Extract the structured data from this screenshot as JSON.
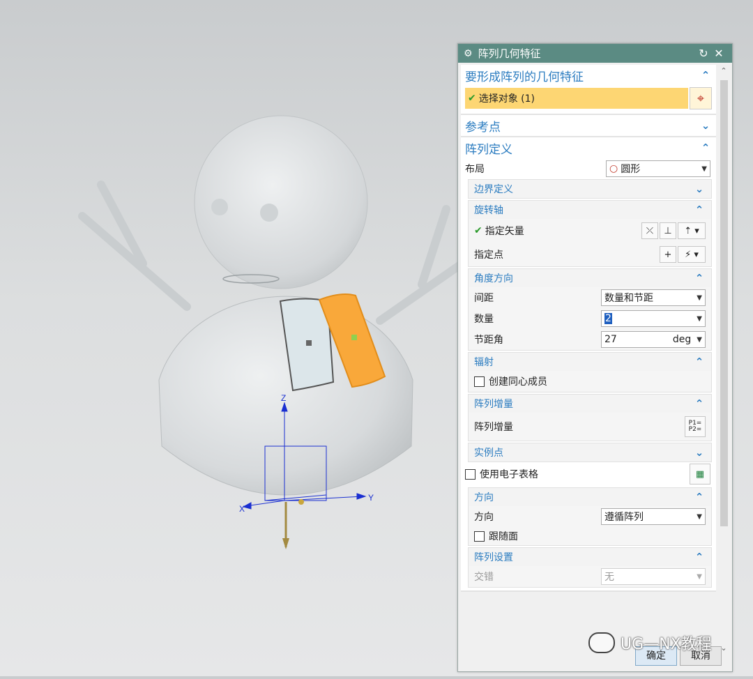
{
  "viewport": {
    "axis_labels": {
      "x": "X",
      "y": "Y",
      "z": "Z"
    },
    "colors": {
      "snowman": "#e2e5e7",
      "selected_feature": "#f9a83a",
      "axis": "#1a2fd1"
    }
  },
  "dialog": {
    "title": "阵列几何特征",
    "title_icons": {
      "gear": "gear-icon",
      "reset": "reset-icon",
      "close": "close-icon"
    },
    "sections": {
      "geometry": {
        "label": "要形成阵列的几何特征",
        "select_label": "选择对象 (1)"
      },
      "reference_point": {
        "label": "参考点"
      },
      "pattern_def": {
        "label": "阵列定义",
        "layout_label": "布局",
        "layout_value": "圆形",
        "boundary": {
          "label": "边界定义"
        },
        "rotation_axis": {
          "label": "旋转轴",
          "vector_label": "指定矢量",
          "point_label": "指定点"
        },
        "angular_direction": {
          "label": "角度方向",
          "spacing_label": "间距",
          "spacing_value": "数量和节距",
          "count_label": "数量",
          "count_value": "2",
          "pitch_label": "节距角",
          "pitch_value": "27",
          "pitch_unit": "deg"
        },
        "radial": {
          "label": "辐射",
          "concentric_label": "创建同心成员"
        },
        "increment": {
          "label": "阵列增量",
          "row_label": "阵列增量"
        },
        "instance_points": {
          "label": "实例点"
        },
        "spreadsheet_label": "使用电子表格"
      },
      "orientation": {
        "label": "方向",
        "dir_label": "方向",
        "dir_value": "遵循阵列",
        "follow_face_label": "跟随面"
      },
      "settings": {
        "label": "阵列设置",
        "stagger_label": "交错",
        "stagger_value": "无"
      }
    },
    "footer": {
      "ok": "确定",
      "cancel": "取消"
    }
  },
  "watermark": {
    "text": "UG—NX教程"
  }
}
